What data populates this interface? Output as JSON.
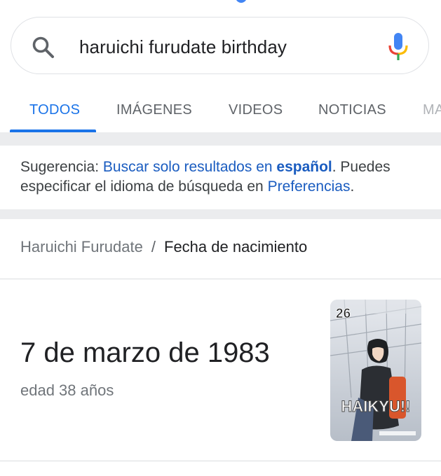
{
  "search": {
    "query": "haruichi furudate birthday",
    "icon": "search-icon",
    "voice_icon": "mic-icon"
  },
  "tabs": [
    {
      "label": "TODOS",
      "active": true
    },
    {
      "label": "IMÁGENES",
      "active": false
    },
    {
      "label": "VIDEOS",
      "active": false
    },
    {
      "label": "NOTICIAS",
      "active": false
    },
    {
      "label": "MA",
      "active": false
    }
  ],
  "suggestion": {
    "prefix": "Sugerencia: ",
    "link1": "Buscar solo resultados en ",
    "link1_bold": "español",
    "middle": ". Puedes especificar el idioma de búsqueda en ",
    "link2": "Preferencias",
    "suffix": "."
  },
  "knowledge": {
    "entity": "Haruichi Furudate",
    "separator": "/",
    "attribute": "Fecha de nacimiento",
    "answer": "7 de marzo de 1983",
    "age": "edad 38 años",
    "image": {
      "volume": "26",
      "title": "HAIKYU!!"
    }
  },
  "colors": {
    "accent": "#1a73e8",
    "link": "#1a5cc0",
    "muted": "#70757a",
    "band": "#ebecee"
  }
}
